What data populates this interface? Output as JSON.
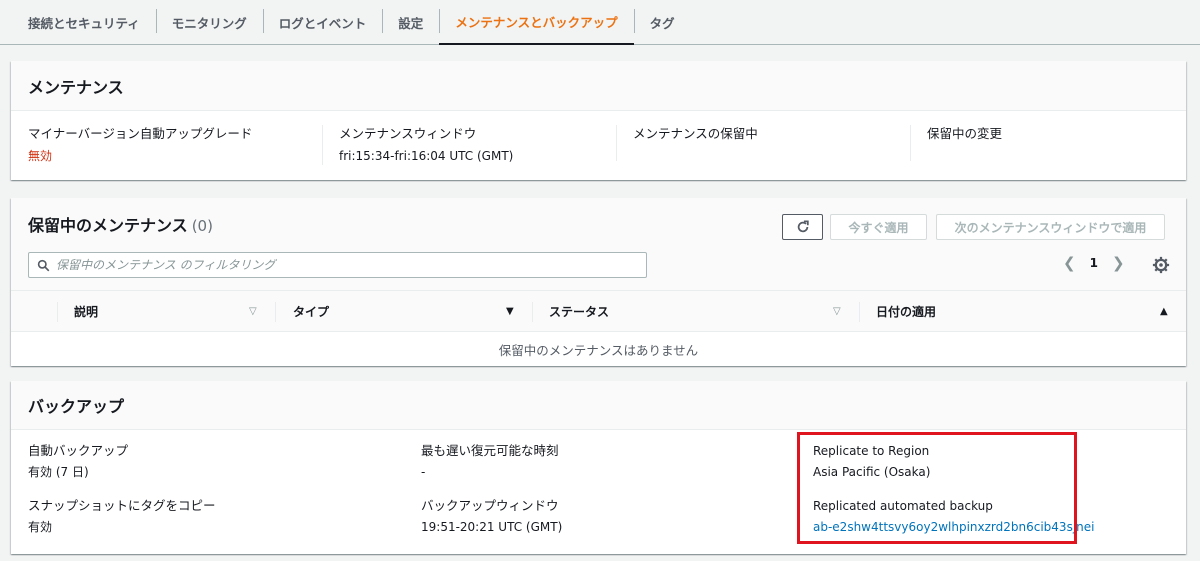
{
  "tabs": [
    {
      "label": "接続とセキュリティ"
    },
    {
      "label": "モニタリング"
    },
    {
      "label": "ログとイベント"
    },
    {
      "label": "設定"
    },
    {
      "label": "メンテナンスとバックアップ"
    },
    {
      "label": "タグ"
    }
  ],
  "maintenance": {
    "title": "メンテナンス",
    "fields": [
      {
        "label": "マイナーバージョン自動アップグレード",
        "value": "無効"
      },
      {
        "label": "メンテナンスウィンドウ",
        "value": "fri:15:34-fri:16:04 UTC (GMT)"
      },
      {
        "label": "メンテナンスの保留中",
        "value": ""
      },
      {
        "label": "保留中の変更",
        "value": ""
      }
    ]
  },
  "pending": {
    "title": "保留中のメンテナンス",
    "count": "(0)",
    "apply_now": "今すぐ適用",
    "apply_next_window": "次のメンテナンスウィンドウで適用",
    "search_placeholder": "保留中のメンテナンス のフィルタリング",
    "page": "1",
    "columns": [
      "説明",
      "タイプ",
      "ステータス",
      "日付の適用"
    ],
    "empty_message": "保留中のメンテナンスはありません"
  },
  "backup": {
    "title": "バックアップ",
    "auto_backup_label": "自動バックアップ",
    "auto_backup_value": "有効 (7 日)",
    "copy_tags_label": "スナップショットにタグをコピー",
    "copy_tags_value": "有効",
    "latest_restore_label": "最も遅い復元可能な時刻",
    "latest_restore_value": "-",
    "backup_window_label": "バックアップウィンドウ",
    "backup_window_value": "19:51-20:21 UTC (GMT)",
    "replicate_region_label": "Replicate to Region",
    "replicate_region_value": "Asia Pacific (Osaka)",
    "replicated_backup_label": "Replicated automated backup",
    "replicated_backup_value": "ab-e2shw4ttsvy6oy2wlhpinxzrd2bn6cib43sjnei"
  },
  "colors": {
    "accent": "#ec7211",
    "danger": "#d13212",
    "link": "#0073bb",
    "highlight": "#e0141e"
  }
}
